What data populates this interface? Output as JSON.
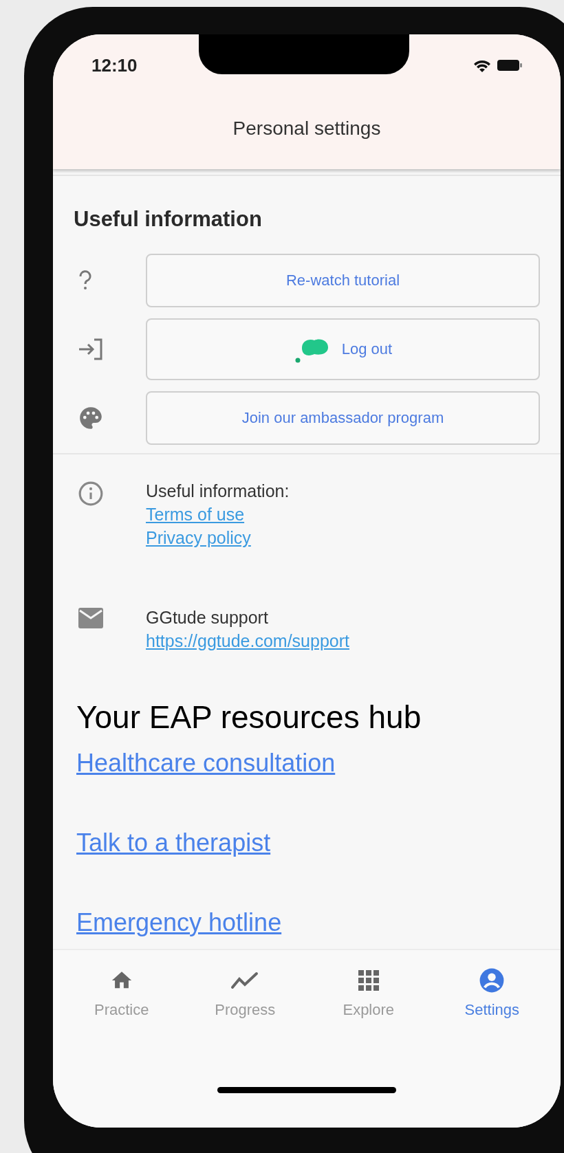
{
  "status_bar": {
    "time": "12:10"
  },
  "header": {
    "title": "Personal settings"
  },
  "useful_section": {
    "heading": "Useful information",
    "buttons": [
      {
        "label": "Re-watch tutorial",
        "kind": "plain"
      },
      {
        "label": "Log out",
        "kind": "with_logo"
      },
      {
        "label": "Join our ambassador program",
        "kind": "plain"
      }
    ]
  },
  "info_rows": [
    {
      "text": "Useful information:",
      "links": [
        "Terms of use",
        "Privacy policy"
      ]
    },
    {
      "text": "GGtude support",
      "links": [
        "https://ggtude.com/support"
      ]
    }
  ],
  "eap": {
    "heading": "Your EAP resources hub",
    "links": [
      "Healthcare consultation",
      "Talk to a therapist",
      "Emergency hotline"
    ]
  },
  "nav": [
    {
      "label": "Practice",
      "selected": false
    },
    {
      "label": "Progress",
      "selected": false
    },
    {
      "label": "Explore",
      "selected": false
    },
    {
      "label": "Settings",
      "selected": true
    }
  ]
}
